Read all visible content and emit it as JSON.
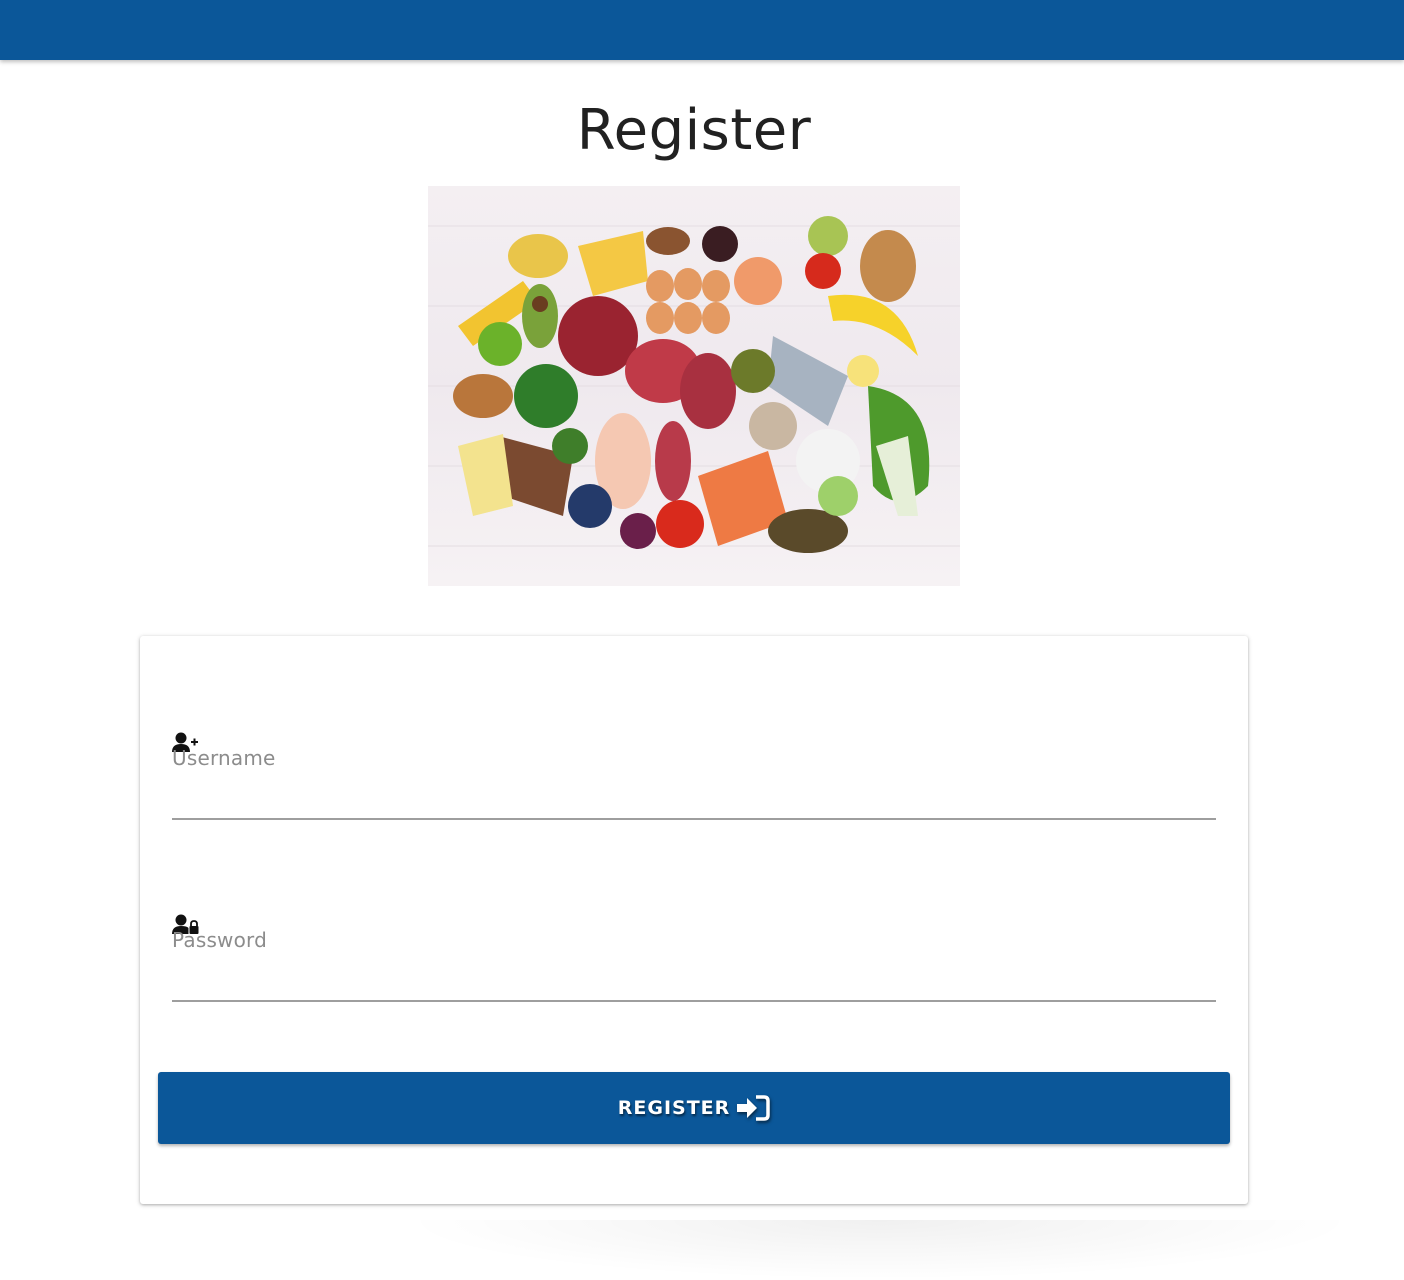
{
  "page": {
    "title": "Register"
  },
  "colors": {
    "primary": "#0b5799",
    "text": "#212121",
    "label": "#8c8c8c",
    "underline": "#9e9e9e"
  },
  "form": {
    "username": {
      "label": "Username",
      "icon": "user-plus-icon",
      "value": ""
    },
    "password": {
      "label": "Password",
      "icon": "user-lock-icon",
      "value": ""
    },
    "submit": {
      "label": "REGISTER",
      "icon": "sign-in-icon"
    }
  },
  "hero_image": {
    "subject": "food-ingredients"
  }
}
